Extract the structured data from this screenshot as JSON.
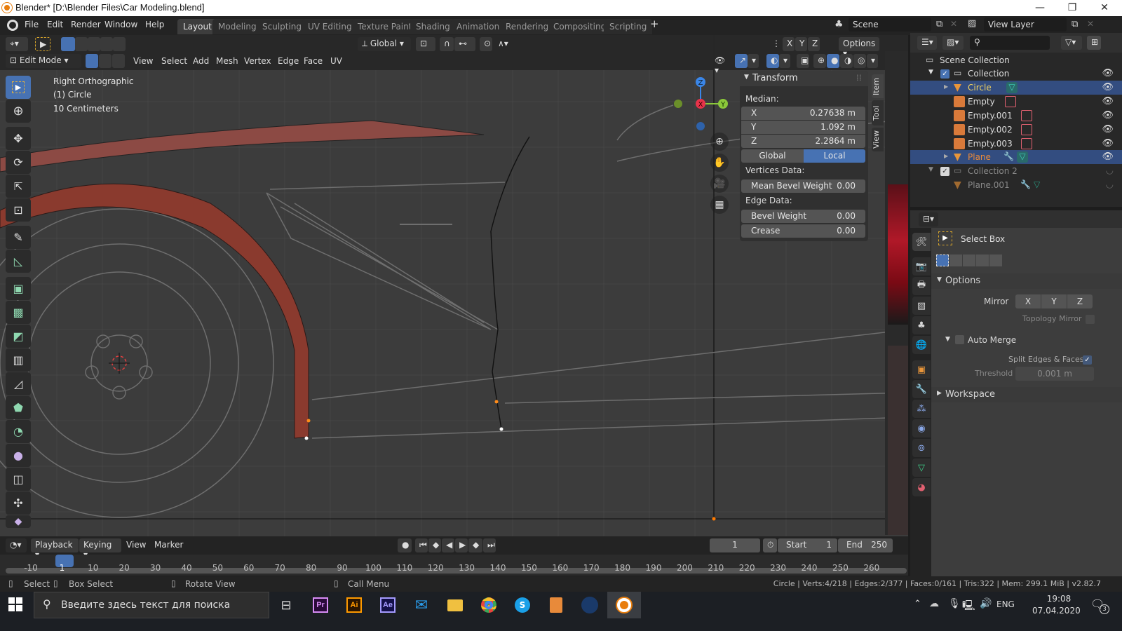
{
  "window": {
    "title": "Blender* [D:\\Blender Files\\Car Modeling.blend]",
    "controls": {
      "minimize": "—",
      "maximize": "❐",
      "close": "✕"
    }
  },
  "menu": {
    "items": [
      "File",
      "Edit",
      "Render",
      "Window",
      "Help"
    ]
  },
  "workspaces": {
    "tabs": [
      "Layout",
      "Modeling",
      "Sculpting",
      "UV Editing",
      "Texture Paint",
      "Shading",
      "Animation",
      "Rendering",
      "Compositing",
      "Scripting"
    ],
    "active": "Layout",
    "add": "+"
  },
  "scene": {
    "label": "Scene",
    "view_layer": "View Layer"
  },
  "tool_header": {
    "orientation": "Global",
    "mirror_axes": [
      "X",
      "Y",
      "Z"
    ],
    "options": "Options"
  },
  "viewport_header": {
    "mode": "Edit Mode",
    "menus": [
      "View",
      "Select",
      "Add",
      "Mesh",
      "Vertex",
      "Edge",
      "Face",
      "UV"
    ]
  },
  "viewport": {
    "overlay_lines": [
      "Right Orthographic",
      "(1) Circle",
      "10 Centimeters"
    ],
    "gizmo": {
      "x": "X",
      "y": "Y",
      "z": "Z"
    },
    "colors": {
      "mesh_fill": "#8a3a2e",
      "background": "#3c3c3c",
      "x_axis": "#e8334a",
      "y_axis": "#8bc83a",
      "z_axis": "#3a86e8"
    }
  },
  "toolbar": {
    "tools": [
      "select-box",
      "cursor",
      "move",
      "rotate",
      "scale",
      "transform",
      "annotate",
      "measure",
      "extrude-region",
      "inset-faces",
      "bevel",
      "loop-cut",
      "knife",
      "poly-build",
      "spin",
      "smooth",
      "edge-slide",
      "shrink-fatten",
      "shear"
    ]
  },
  "npanel": {
    "title": "Transform",
    "median_label": "Median:",
    "x": {
      "label": "X",
      "value": "0.27638 m"
    },
    "y": {
      "label": "Y",
      "value": "1.092 m"
    },
    "z": {
      "label": "Z",
      "value": "2.2864 m"
    },
    "space": {
      "global": "Global",
      "local": "Local",
      "active": "Local"
    },
    "vertices_data_label": "Vertices Data:",
    "mean_bevel_weight": {
      "label": "Mean Bevel Weight",
      "value": "0.00"
    },
    "edge_data_label": "Edge Data:",
    "bevel_weight": {
      "label": "Bevel Weight",
      "value": "0.00"
    },
    "crease": {
      "label": "Crease",
      "value": "0.00"
    },
    "tabs": [
      "Item",
      "Tool",
      "View"
    ]
  },
  "outliner": {
    "root": "Scene Collection",
    "rows": [
      {
        "name": "Collection",
        "type": "collection"
      },
      {
        "name": "Circle",
        "type": "mesh",
        "selected": true
      },
      {
        "name": "Empty",
        "type": "empty"
      },
      {
        "name": "Empty.001",
        "type": "empty"
      },
      {
        "name": "Empty.002",
        "type": "empty"
      },
      {
        "name": "Empty.003",
        "type": "empty"
      },
      {
        "name": "Plane",
        "type": "mesh",
        "selected": true
      },
      {
        "name": "Collection 2",
        "type": "collection"
      },
      {
        "name": "Plane.001",
        "type": "mesh"
      }
    ]
  },
  "properties": {
    "tool_name": "Select Box",
    "options_label": "Options",
    "mirror_label": "Mirror",
    "mirror_axes": [
      "X",
      "Y",
      "Z"
    ],
    "topology_mirror": "Topology Mirror",
    "auto_merge": "Auto Merge",
    "split_edges": "Split Edges & Faces",
    "threshold_label": "Threshold",
    "threshold_value": "0.001 m",
    "workspace_label": "Workspace"
  },
  "timeline": {
    "menus": [
      "Playback",
      "Keying",
      "View",
      "Marker"
    ],
    "current_frame": "1",
    "start_label": "Start",
    "start": "1",
    "end_label": "End",
    "end": "250",
    "ticks": [
      "-10",
      "1",
      "10",
      "20",
      "30",
      "40",
      "50",
      "60",
      "70",
      "80",
      "90",
      "100",
      "110",
      "120",
      "130",
      "140",
      "150",
      "160",
      "170",
      "180",
      "190",
      "200",
      "210",
      "220",
      "230",
      "240",
      "250",
      "260"
    ]
  },
  "statusbar": {
    "select": "Select",
    "box_select": "Box Select",
    "rotate_view": "Rotate View",
    "call_menu": "Call Menu",
    "stats": "Circle | Verts:4/218 | Edges:2/377 | Faces:0/161 | Tris:322 | Mem: 299.1 MiB | v2.82.7"
  },
  "taskbar": {
    "search_placeholder": "Введите здесь текст для поиска",
    "apps": [
      {
        "name": "Pr",
        "color": "#d78cf5"
      },
      {
        "name": "Ai",
        "color": "#ff9a00"
      },
      {
        "name": "Ae",
        "color": "#a59bff"
      }
    ],
    "lang": "ENG",
    "time": "19:08",
    "date": "07.04.2020",
    "notifications": "3"
  }
}
